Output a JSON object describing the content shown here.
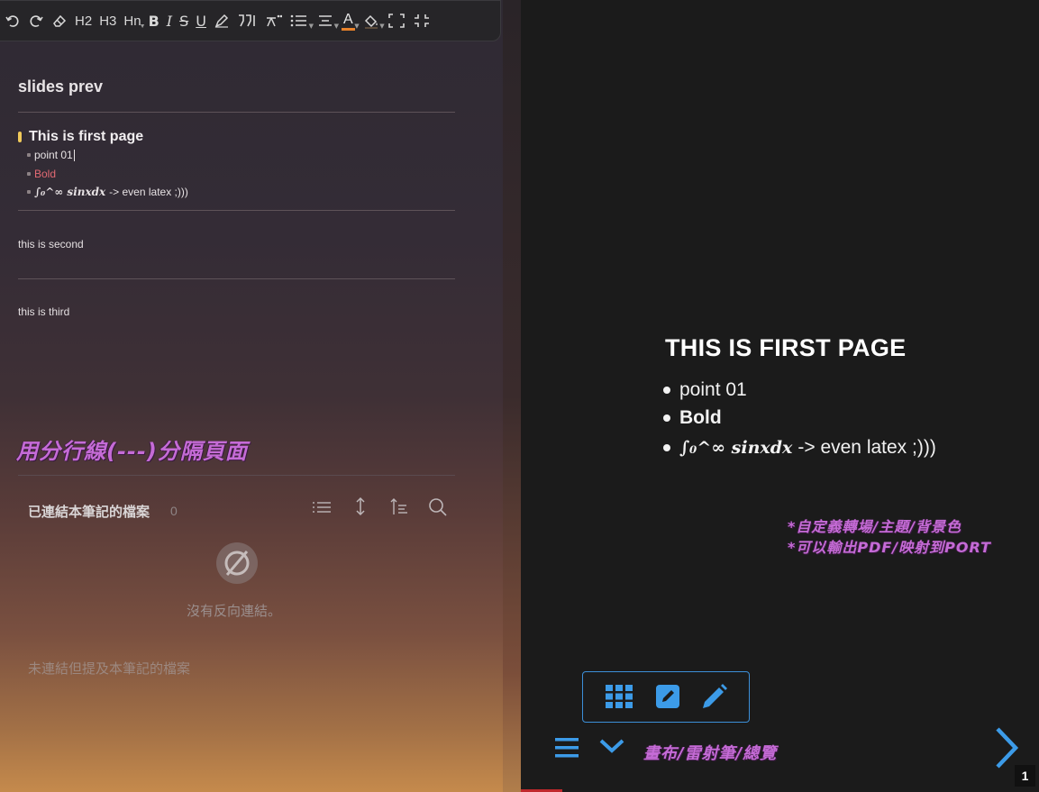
{
  "toolbar": {
    "h2": "H2",
    "h3": "H3",
    "hn": "Hn",
    "bold": "B",
    "italic": "I",
    "strike": "S",
    "underline": "U",
    "font_color": "A"
  },
  "note": {
    "title": "slides prev",
    "slide1": {
      "heading": "This is first page",
      "items": [
        "point 01",
        "Bold",
        "-> even latex ;)))"
      ],
      "latex": "∫₀^∞ sinxdx"
    },
    "second": "this is second",
    "third": "this is third",
    "annotation": "用分行線(---)分隔頁面"
  },
  "backlinks": {
    "title": "已連結本筆記的檔案",
    "count": "0",
    "empty": "沒有反向連結。",
    "unlinked": "未連結但提及本筆記的檔案"
  },
  "slide": {
    "heading": "THIS IS FIRST PAGE",
    "items": [
      "point 01",
      "Bold",
      "-> even latex ;)))"
    ],
    "latex": "∫₀^∞ sinxdx",
    "annotation_line1": "*自定義轉場/主題/背景色",
    "annotation_line2": "*可以輸出PDF/映射到PORT",
    "controls_annotation": "畫布/雷射筆/總覽",
    "page_number": "1"
  },
  "colors": {
    "accent": "#3c9be8",
    "annotation": "#c56bd6",
    "bold_red": "#e26a73",
    "heading_marker": "#f0c95a"
  }
}
